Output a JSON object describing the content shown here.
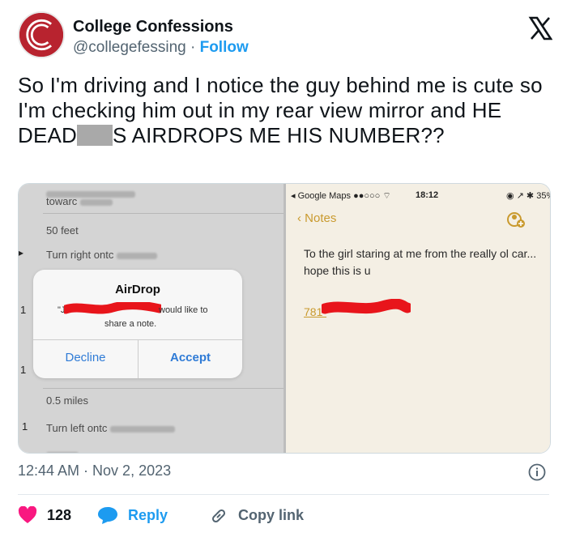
{
  "author": {
    "name": "College Confessions",
    "handle": "@collegefessing",
    "separator": "·",
    "follow_label": "Follow",
    "avatar_letter": "C"
  },
  "tweet": {
    "text_before": "So I'm driving and I notice the guy behind me is cute so I'm checking him out in my rear view mirror and HE DEAD",
    "text_after": "S AIRDROPS ME HIS NUMBER??"
  },
  "left_screenshot": {
    "nav_lines": [
      {
        "text": "towarc"
      },
      {
        "text": "50 feet"
      },
      {
        "text": "Turn right ontc"
      },
      {
        "text": "0.5 miles"
      },
      {
        "text": "Turn left ontc"
      }
    ],
    "airdrop": {
      "title": "AirDrop",
      "message_start": "\"J",
      "message_end": "would like to",
      "message_line2": "share a note.",
      "decline_label": "Decline",
      "accept_label": "Accept"
    }
  },
  "right_screenshot": {
    "status_app": "Google Maps",
    "status_signal": "●●○○○",
    "status_time": "18:12",
    "status_battery": "35%",
    "back_label": "Notes",
    "note_text": "To the girl staring at me from the really ol car... hope this is u",
    "phone_prefix": "781-"
  },
  "footer": {
    "timestamp": "12:44 AM · Nov 2, 2023",
    "likes": "128",
    "reply_label": "Reply",
    "copy_label": "Copy link"
  },
  "colors": {
    "brand_red": "#b8232f",
    "link_blue": "#1d9bf0",
    "like_pink": "#f91880",
    "notes_gold": "#c99a2e"
  },
  "icons": [
    "x-logo-icon",
    "info-icon",
    "heart-icon",
    "speech-bubble-icon",
    "link-icon",
    "chevron-left-icon",
    "share-contact-icon"
  ]
}
